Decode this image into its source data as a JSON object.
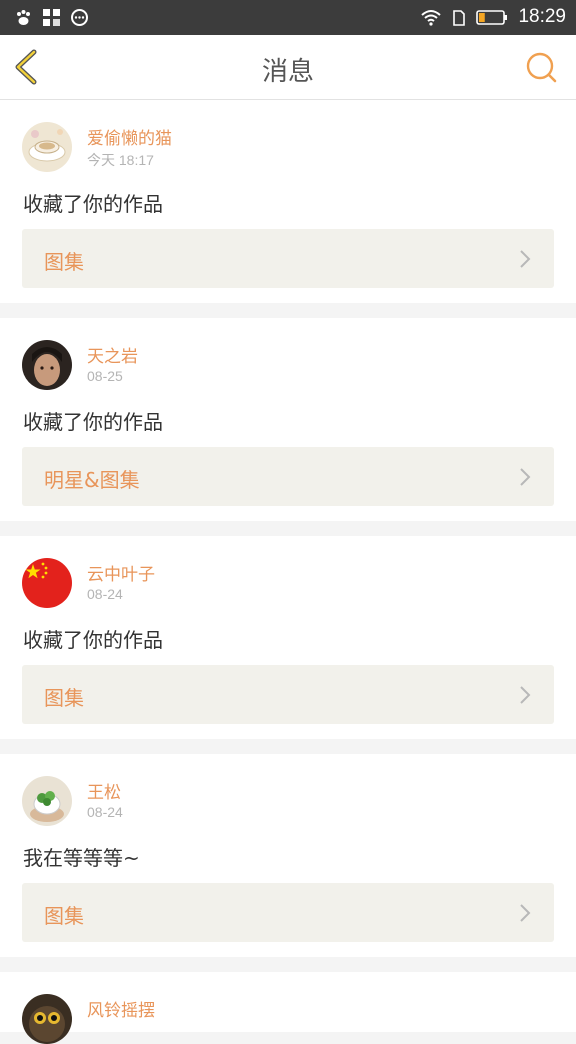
{
  "status_bar": {
    "left_icons": [
      "baidu-paw-icon",
      "app-grid-icon",
      "chat-bubble-icon"
    ],
    "right_icons": [
      "wifi-icon",
      "sim-icon",
      "battery-icon"
    ],
    "time": "18:29",
    "battery_level": 0.25
  },
  "header": {
    "title": "消息",
    "back_icon": "chevron-left-icon",
    "search_icon": "search-icon",
    "accent_color": "#f0a050"
  },
  "messages": [
    {
      "user": "爱偷懒的猫",
      "time": "今天 18:17",
      "text": "收藏了你的作品",
      "collection": "图集",
      "avatar": "teacup-photo"
    },
    {
      "user": "天之岩",
      "time": "08-25",
      "text": "收藏了你的作品",
      "collection": "明星&图集",
      "avatar": "portrait-photo"
    },
    {
      "user": "云中叶子",
      "time": "08-24",
      "text": "收藏了你的作品",
      "collection": "图集",
      "avatar": "china-flag"
    },
    {
      "user": "王松",
      "time": "08-24",
      "text": "我在等等等~",
      "collection": "图集",
      "avatar": "plant-photo"
    },
    {
      "user": "风铃摇摆",
      "time": "",
      "text": "",
      "collection": "",
      "avatar": "owl-photo"
    }
  ],
  "colors": {
    "name_color": "#e8955a",
    "collection_bg": "#f2f1eb",
    "time_color": "#b4b4b4"
  }
}
